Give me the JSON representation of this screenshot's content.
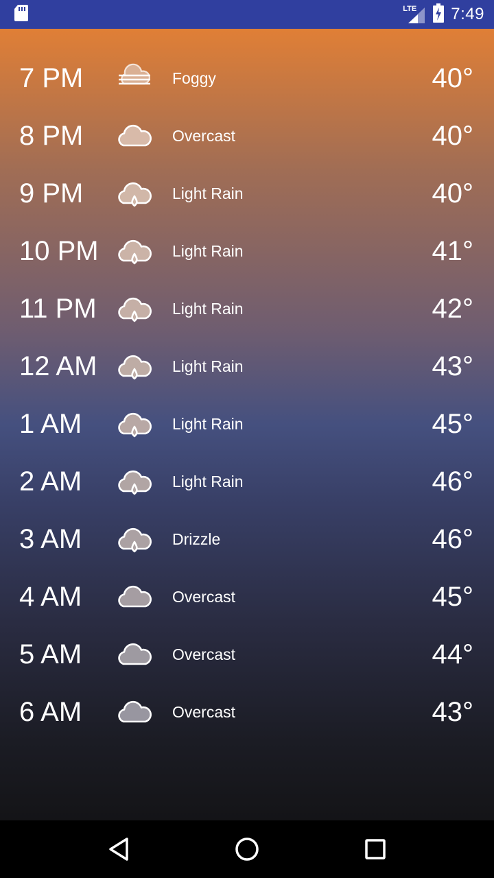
{
  "status_bar": {
    "time": "7:49",
    "network": "LTE",
    "icons": [
      "sd-card-icon",
      "lte-signal-icon",
      "battery-charging-icon"
    ]
  },
  "hourly": [
    {
      "time": "7 PM",
      "icon": "fog-icon",
      "condition": "Foggy",
      "temp": "40°"
    },
    {
      "time": "8 PM",
      "icon": "cloud-icon",
      "condition": "Overcast",
      "temp": "40°"
    },
    {
      "time": "9 PM",
      "icon": "rain-cloud-icon",
      "condition": "Light Rain",
      "temp": "40°"
    },
    {
      "time": "10 PM",
      "icon": "rain-cloud-icon",
      "condition": "Light Rain",
      "temp": "41°"
    },
    {
      "time": "11 PM",
      "icon": "rain-cloud-icon",
      "condition": "Light Rain",
      "temp": "42°"
    },
    {
      "time": "12 AM",
      "icon": "rain-cloud-icon",
      "condition": "Light Rain",
      "temp": "43°"
    },
    {
      "time": "1 AM",
      "icon": "rain-cloud-icon",
      "condition": "Light Rain",
      "temp": "45°"
    },
    {
      "time": "2 AM",
      "icon": "rain-cloud-icon",
      "condition": "Light Rain",
      "temp": "46°"
    },
    {
      "time": "3 AM",
      "icon": "rain-cloud-icon",
      "condition": "Drizzle",
      "temp": "46°"
    },
    {
      "time": "4 AM",
      "icon": "cloud-icon",
      "condition": "Overcast",
      "temp": "45°"
    },
    {
      "time": "5 AM",
      "icon": "cloud-icon",
      "condition": "Overcast",
      "temp": "44°"
    },
    {
      "time": "6 AM",
      "icon": "cloud-icon",
      "condition": "Overcast",
      "temp": "43°"
    }
  ],
  "nav_bar": {
    "icons": [
      "back-icon",
      "home-icon",
      "recents-icon"
    ]
  },
  "colors": {
    "status_bar": "#303f9f",
    "gradient_top": "#e07f36",
    "gradient_mid": "#45507f",
    "gradient_bottom": "#141417"
  }
}
